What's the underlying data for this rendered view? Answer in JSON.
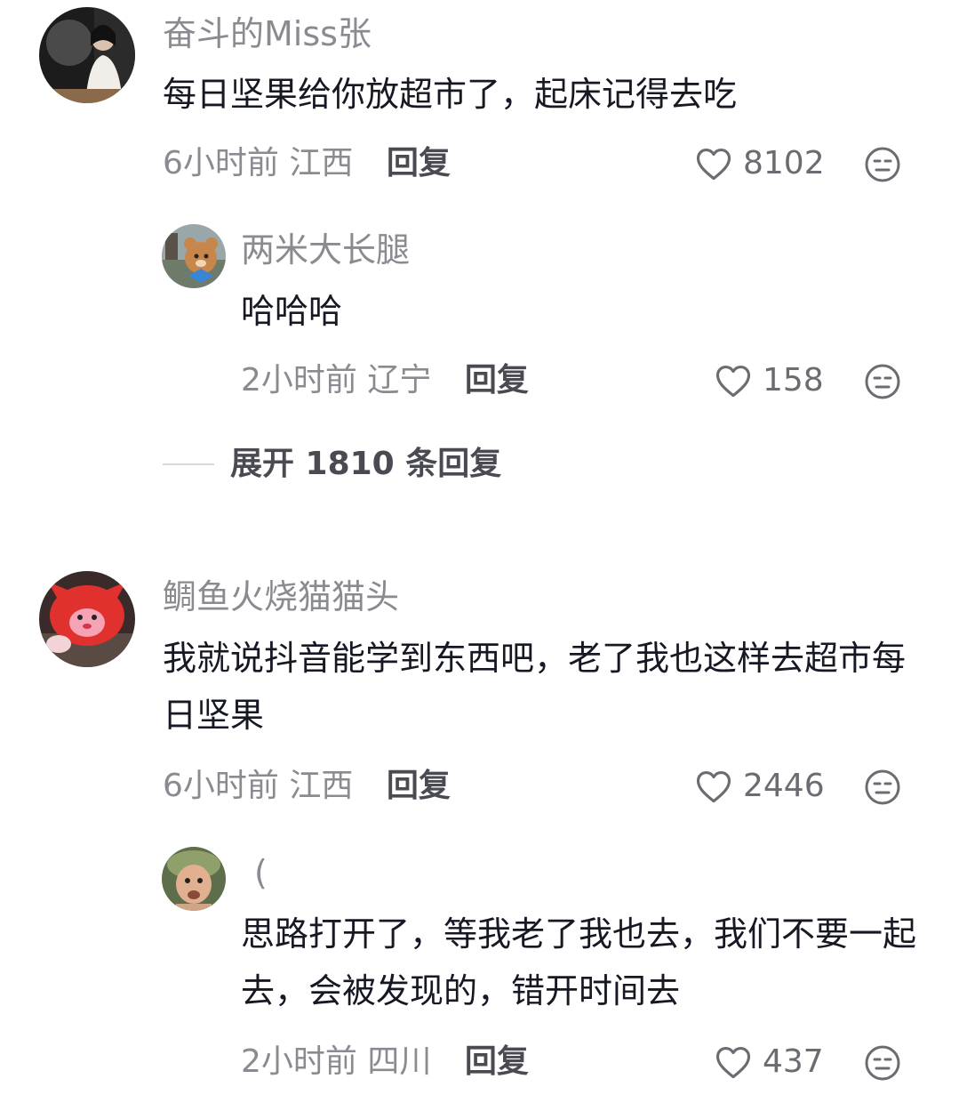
{
  "comments": [
    {
      "username": "奋斗的Miss张",
      "text": "每日坚果给你放超市了，起床记得去吃",
      "time": "6小时前",
      "location": "江西",
      "reply_label": "回复",
      "likes": "8102"
    },
    {
      "username": "两米大长腿",
      "text": "哈哈哈",
      "time": "2小时前",
      "location": "辽宁",
      "reply_label": "回复",
      "likes": "158"
    },
    {
      "username": "鲷鱼火烧猫猫头",
      "text": "我就说抖音能学到东西吧，老了我也这样去超市每日坚果",
      "time": "6小时前",
      "location": "江西",
      "reply_label": "回复",
      "likes": "2446"
    },
    {
      "username": "(",
      "text": "思路打开了，等我老了我也去，我们不要一起去，会被发现的，错开时间去",
      "time": "2小时前",
      "location": "四川",
      "reply_label": "回复",
      "likes": "437"
    }
  ],
  "expand_replies": "展开 1810 条回复",
  "icons": {
    "like": "heart-outline-icon",
    "dislike": "meh-face-icon"
  },
  "colors": {
    "text_primary": "#161823",
    "text_secondary": "#8a8b91",
    "reply_link": "#4a4b52"
  }
}
